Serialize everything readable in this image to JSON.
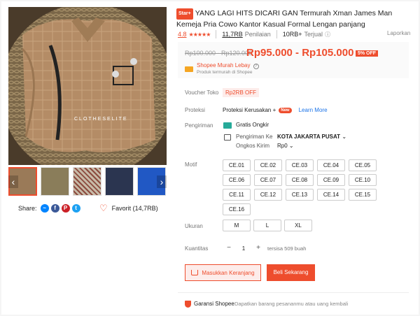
{
  "product": {
    "badge": "Star+",
    "title": "YANG LAGI HITS DICARI GAN Termurah Xman James Man Kemeja Pria Cowo Kantor Kasual Formal Lengan panjang",
    "watermark": "CLOTHESELITE",
    "rating": "4.8",
    "stars": "★★★★★",
    "ratings_count": "11,7RB",
    "ratings_label": "Penilaian",
    "sold_count": "10RB+",
    "sold_label": "Terjual",
    "report_label": "Laporkan"
  },
  "price": {
    "old": "Rp100.000 - Rp120.000",
    "current": "Rp95.000 - Rp105.000",
    "discount": "5% OFF",
    "program": "Shopee Murah Lebay",
    "program_sub": "Produk termurah di Shopee"
  },
  "labels": {
    "voucher": "Voucher Toko",
    "protection": "Proteksi",
    "shipping": "Pengiriman",
    "motif": "Motif",
    "size": "Ukuran",
    "quantity": "Kuantitas"
  },
  "voucher": {
    "chip": "Rp2RB OFF"
  },
  "protection": {
    "text": "Proteksi Kerusakan +",
    "new_badge": "New",
    "learn_more": "Learn More"
  },
  "shipping": {
    "free_label": "Gratis Ongkir",
    "to_label": "Pengiriman Ke",
    "to_value": "KOTA JAKARTA PUSAT",
    "cost_label": "Ongkos Kirim",
    "cost_value": "Rp0"
  },
  "motifs": [
    "CE.01",
    "CE.02",
    "CE.03",
    "CE.04",
    "CE.05",
    "CE.06",
    "CE.07",
    "CE.08",
    "CE.09",
    "CE.10",
    "CE.11",
    "CE.12",
    "CE.13",
    "CE.14",
    "CE.15",
    "CE.16"
  ],
  "sizes": [
    "M",
    "L",
    "XL"
  ],
  "quantity": {
    "minus": "−",
    "value": "1",
    "plus": "+",
    "stock": "tersisa 509 buah"
  },
  "actions": {
    "add_to_cart": "Masukkan Keranjang",
    "buy_now": "Beli Sekarang"
  },
  "guarantee": {
    "title": "Garansi Shopee",
    "sub": "Dapatkan barang pesananmu atau uang kembali"
  },
  "share": {
    "label": "Share:",
    "icons": [
      "messenger-icon",
      "facebook-icon",
      "pinterest-icon",
      "twitter-icon"
    ]
  },
  "favorite": {
    "label": "Favorit (14,7RB)"
  },
  "colors": {
    "accent": "#ee4d2d",
    "teal": "#26aa99",
    "blue": "#1a73e8"
  }
}
